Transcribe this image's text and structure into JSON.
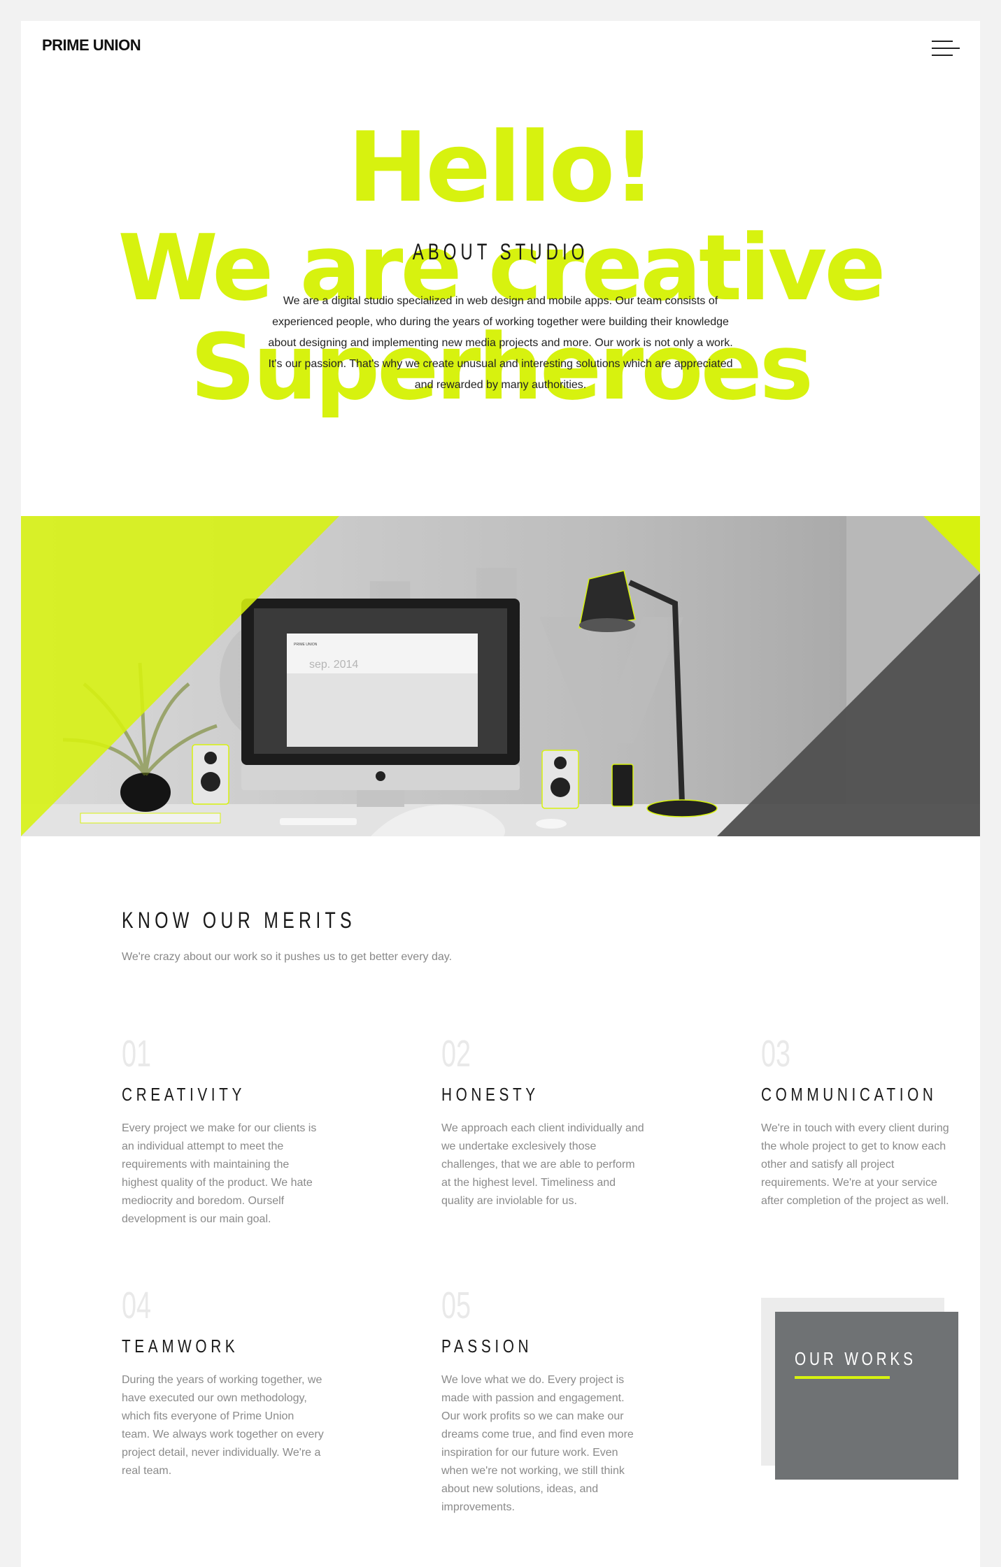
{
  "header": {
    "logo": "PRIME UNION"
  },
  "hero": {
    "line1": "Hello!",
    "line2": "We are creative",
    "line3": "Superheroes",
    "about_title": "ABOUT STUDIO",
    "about_text": "We are a digital studio specialized in web design and mobile apps. Our team consists of experienced people, who during the years of working together were building their knowledge about designing and implementing new media projects and more. Our work is not only a work. It's our passion. That's why we create unusual and interesting solutions which are appreciated and rewarded by many authorities."
  },
  "banner": {
    "watermark": "ctiv",
    "screen_text": "sep. 2014",
    "screen_brand": "PRIME UNION"
  },
  "merits": {
    "title": "KNOW OUR MERITS",
    "subtitle": "We're crazy about our work so it pushes us to get better every day.",
    "items": [
      {
        "num": "01",
        "title": "CREATIVITY",
        "text": "Every project we make for our clients is an individual attempt to meet the requirements with maintaining the highest quality of the product. We hate mediocrity and boredom. Ourself development is our main goal."
      },
      {
        "num": "02",
        "title": "HONESTY",
        "text": "We approach each client individually and we undertake exclesively those challenges, that we are able to perform at the highest level. Timeliness and quality are inviolable for us."
      },
      {
        "num": "03",
        "title": "COMMUNICATION",
        "text": "We're in touch with every client during the whole project to get to know each other and satisfy all project requirements. We're at your service after completion of the project as well."
      },
      {
        "num": "04",
        "title": "TEAMWORK",
        "text": "During the years of working together, we have executed our own methodology, which fits everyone of Prime Union team. We always work together on every project detail, never individually. We're a real team."
      },
      {
        "num": "05",
        "title": "PASSION",
        "text": "We love what we do. Every project is made with passion and engagement. Our work profits so we can make our dreams come true, and find even more inspiration for our future work. Even when we're not working, we still think about new solutions, ideas, and improvements."
      }
    ]
  },
  "works": {
    "label": "OUR WORKS"
  },
  "colors": {
    "accent": "#d7f20f",
    "works_box": "#6f7274"
  }
}
